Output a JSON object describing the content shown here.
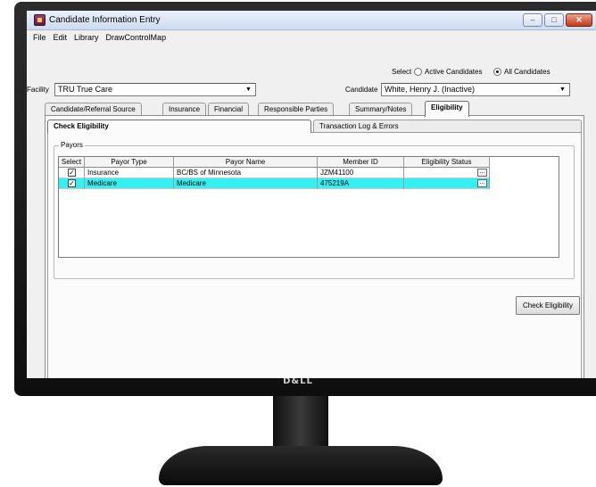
{
  "window": {
    "title": "Candidate Information Entry"
  },
  "menu": [
    "File",
    "Edit",
    "Library",
    "DrawControlMap"
  ],
  "select_filter": {
    "label": "Select",
    "options": [
      "Active Candidates",
      "All Candidates"
    ],
    "selected": "All Candidates"
  },
  "facility": {
    "label": "Facility",
    "value": "TRU True Care"
  },
  "candidate": {
    "label": "Candidate",
    "value": "White, Henry J. (Inactive)"
  },
  "tabs": [
    "Candidate/Referral Source",
    "Insurance",
    "Financial",
    "Responsible Parties",
    "Summary/Notes",
    "Eligibility"
  ],
  "active_tab": "Eligibility",
  "subtabs": [
    "Check Eligibility",
    "Transaction Log & Errors"
  ],
  "active_subtab": "Check Eligibility",
  "payors": {
    "group_title": "Payors",
    "columns": [
      "Select",
      "Payor Type",
      "Payor Name",
      "Member ID",
      "Eligibility Status"
    ],
    "rows": [
      {
        "selected": true,
        "type": "Insurance",
        "name": "BC/BS of Minnesota",
        "member_id": "JZM41100",
        "status": ""
      },
      {
        "selected": true,
        "type": "Medicare",
        "name": "Medicare",
        "member_id": "475219A",
        "status": ""
      }
    ],
    "highlight_color": "#33f0f2"
  },
  "buttons": {
    "check_eligibility": "Check Eligibility"
  },
  "monitor": {
    "brand": "D&LL"
  }
}
